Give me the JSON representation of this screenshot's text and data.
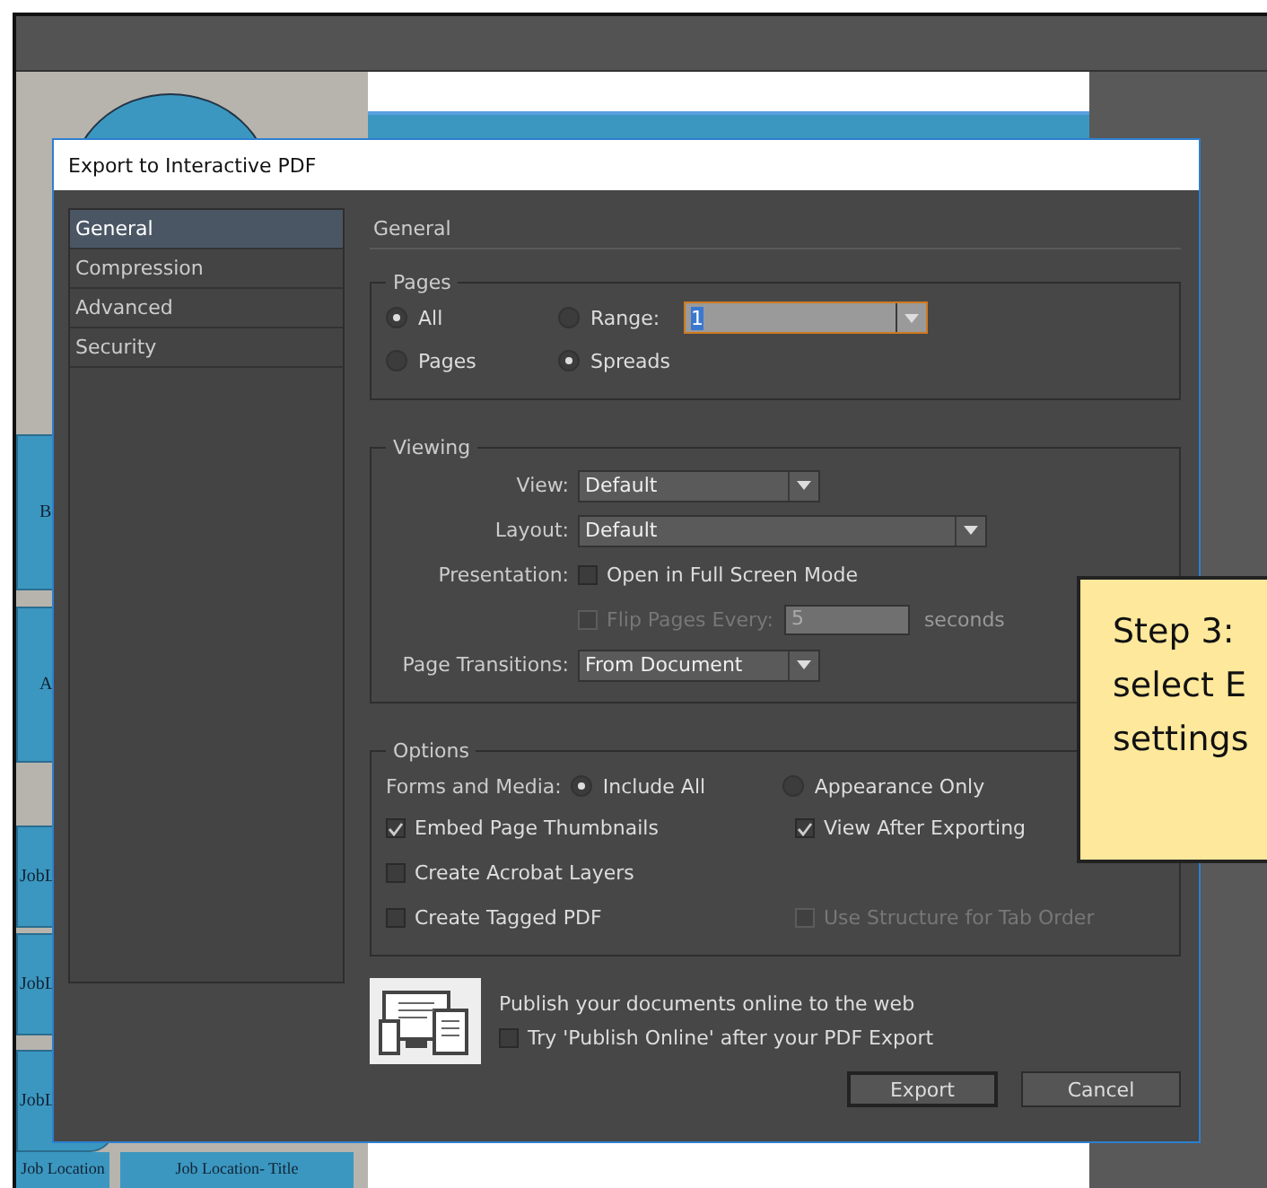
{
  "document_labels": [
    {
      "text": "B",
      "kind": "large"
    },
    {
      "text": "A",
      "kind": "large"
    },
    {
      "text": "JobL",
      "kind": "small"
    },
    {
      "text": "JobL",
      "kind": "small"
    },
    {
      "text": "JobL",
      "kind": "small"
    }
  ],
  "document_footer": {
    "left": "Job Location",
    "middle": "Job Location- Title"
  },
  "dialog": {
    "title": "Export to Interactive PDF",
    "nav": [
      {
        "label": "General",
        "selected": true
      },
      {
        "label": "Compression",
        "selected": false
      },
      {
        "label": "Advanced",
        "selected": false
      },
      {
        "label": "Security",
        "selected": false
      }
    ],
    "section_title": "General",
    "pages": {
      "legend": "Pages",
      "radios": [
        {
          "label": "All",
          "selected": true
        },
        {
          "label": "Range:",
          "selected": false
        },
        {
          "label": "Pages",
          "selected": false
        },
        {
          "label": "Spreads",
          "selected": true
        }
      ],
      "range_value": "1"
    },
    "viewing": {
      "legend": "Viewing",
      "view_label": "View:",
      "view_value": "Default",
      "layout_label": "Layout:",
      "layout_value": "Default",
      "presentation_label": "Presentation:",
      "full_screen": {
        "label": "Open in Full Screen Mode",
        "checked": false,
        "disabled": false
      },
      "flip_pages": {
        "label": "Flip Pages Every:",
        "checked": false,
        "disabled": true
      },
      "flip_value": "5",
      "flip_unit": "seconds",
      "transitions_label": "Page Transitions:",
      "transitions_value": "From Document"
    },
    "options": {
      "legend": "Options",
      "forms_label": "Forms and Media:",
      "forms_radios": [
        {
          "label": "Include All",
          "selected": true
        },
        {
          "label": "Appearance Only",
          "selected": false
        }
      ],
      "checkboxes": [
        {
          "label": "Embed Page Thumbnails",
          "checked": true,
          "disabled": false
        },
        {
          "label": "View After Exporting",
          "checked": true,
          "disabled": false
        },
        {
          "label": "Create Acrobat Layers",
          "checked": false,
          "disabled": false
        },
        {
          "label": "Create Tagged PDF",
          "checked": false,
          "disabled": false
        },
        {
          "label": "Use Structure for Tab Order",
          "checked": false,
          "disabled": true
        }
      ]
    },
    "publish": {
      "text": "Publish your documents online to the web",
      "checkbox": {
        "label": "Try 'Publish Online' after your PDF Export",
        "checked": false,
        "disabled": false
      }
    },
    "buttons": [
      {
        "label": "Export",
        "default": true
      },
      {
        "label": "Cancel",
        "default": false
      }
    ]
  },
  "callout": {
    "lines": [
      "Step 3:",
      "select E",
      "settings"
    ]
  }
}
